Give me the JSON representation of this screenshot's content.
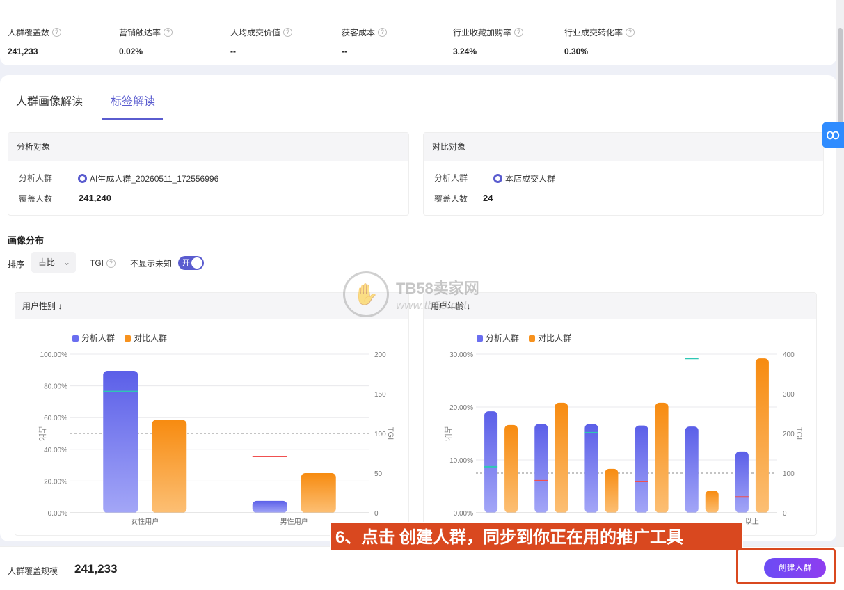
{
  "metrics": [
    {
      "label": "人群覆盖数",
      "value": "241,233"
    },
    {
      "label": "营销触达率",
      "value": "0.02%"
    },
    {
      "label": "人均成交价值",
      "value": "--"
    },
    {
      "label": "获客成本",
      "value": "--"
    },
    {
      "label": "行业收藏加购率",
      "value": "3.24%"
    },
    {
      "label": "行业成交转化率",
      "value": "0.30%"
    }
  ],
  "tabs": [
    "人群画像解读",
    "标签解读"
  ],
  "analysis": {
    "title": "分析对象",
    "group_label": "分析人群",
    "group_value": "AI生成人群_20260511_172556996",
    "cover_label": "覆盖人数",
    "cover_value": "241,240"
  },
  "compare": {
    "title": "对比对象",
    "group_label": "分析人群",
    "group_value": "本店成交人群",
    "cover_label": "覆盖人数",
    "cover_value": "24"
  },
  "distribution": {
    "title": "画像分布",
    "sort_label": "排序",
    "sort_value": "占比",
    "tgi_label": "TGI",
    "hide_unknown_label": "不显示未知",
    "toggle_label": "开"
  },
  "legend": {
    "analysis": "分析人群",
    "compare": "对比人群"
  },
  "colors": {
    "primary": "#5a5ccf",
    "analysis": "#6a6ef0",
    "compare": "#f7921e",
    "accent": "#d9481f"
  },
  "chart_data": [
    {
      "type": "bar",
      "title": "用户性别 ↓",
      "categories": [
        "女性用户",
        "男性用户"
      ],
      "series": [
        {
          "name": "分析人群",
          "values": [
            89.5,
            7.5
          ]
        },
        {
          "name": "对比人群",
          "values": [
            58.5,
            25
          ]
        }
      ],
      "tgi": [
        153,
        71
      ],
      "ylabel": "占比",
      "y2label": "TGI",
      "ylim": [
        0,
        100
      ],
      "y2lim": [
        0,
        200
      ],
      "yticks": [
        "0.00%",
        "20.00%",
        "40.00%",
        "60.00%",
        "80.00%",
        "100.00%"
      ],
      "y2ticks": [
        "0",
        "50",
        "100",
        "150",
        "200"
      ]
    },
    {
      "type": "bar",
      "title": "用户年龄 ↓",
      "categories": [
        "",
        "",
        "",
        "",
        "",
        "以上"
      ],
      "series": [
        {
          "name": "分析人群",
          "values": [
            19.2,
            16.8,
            16.8,
            16.5,
            16.3,
            11.6
          ]
        },
        {
          "name": "对比人群",
          "values": [
            16.6,
            20.8,
            8.3,
            20.8,
            4.2,
            29.2
          ]
        }
      ],
      "tgi": [
        116,
        81,
        202,
        79,
        389,
        40
      ],
      "ylabel": "占比",
      "y2label": "TGI",
      "ylim": [
        0,
        30
      ],
      "y2lim": [
        0,
        400
      ],
      "yticks": [
        "0.00%",
        "10.00%",
        "20.00%",
        "30.00%"
      ],
      "y2ticks": [
        "0",
        "100",
        "200",
        "300",
        "400"
      ]
    }
  ],
  "watermark": {
    "title": "TB58卖家网",
    "url": "www.tb58.net"
  },
  "banner": "6、点击 创建人群，同步到你正在用的推广工具",
  "bottom": {
    "label": "人群覆盖规模",
    "value": "241,233",
    "button": "创建人群"
  }
}
